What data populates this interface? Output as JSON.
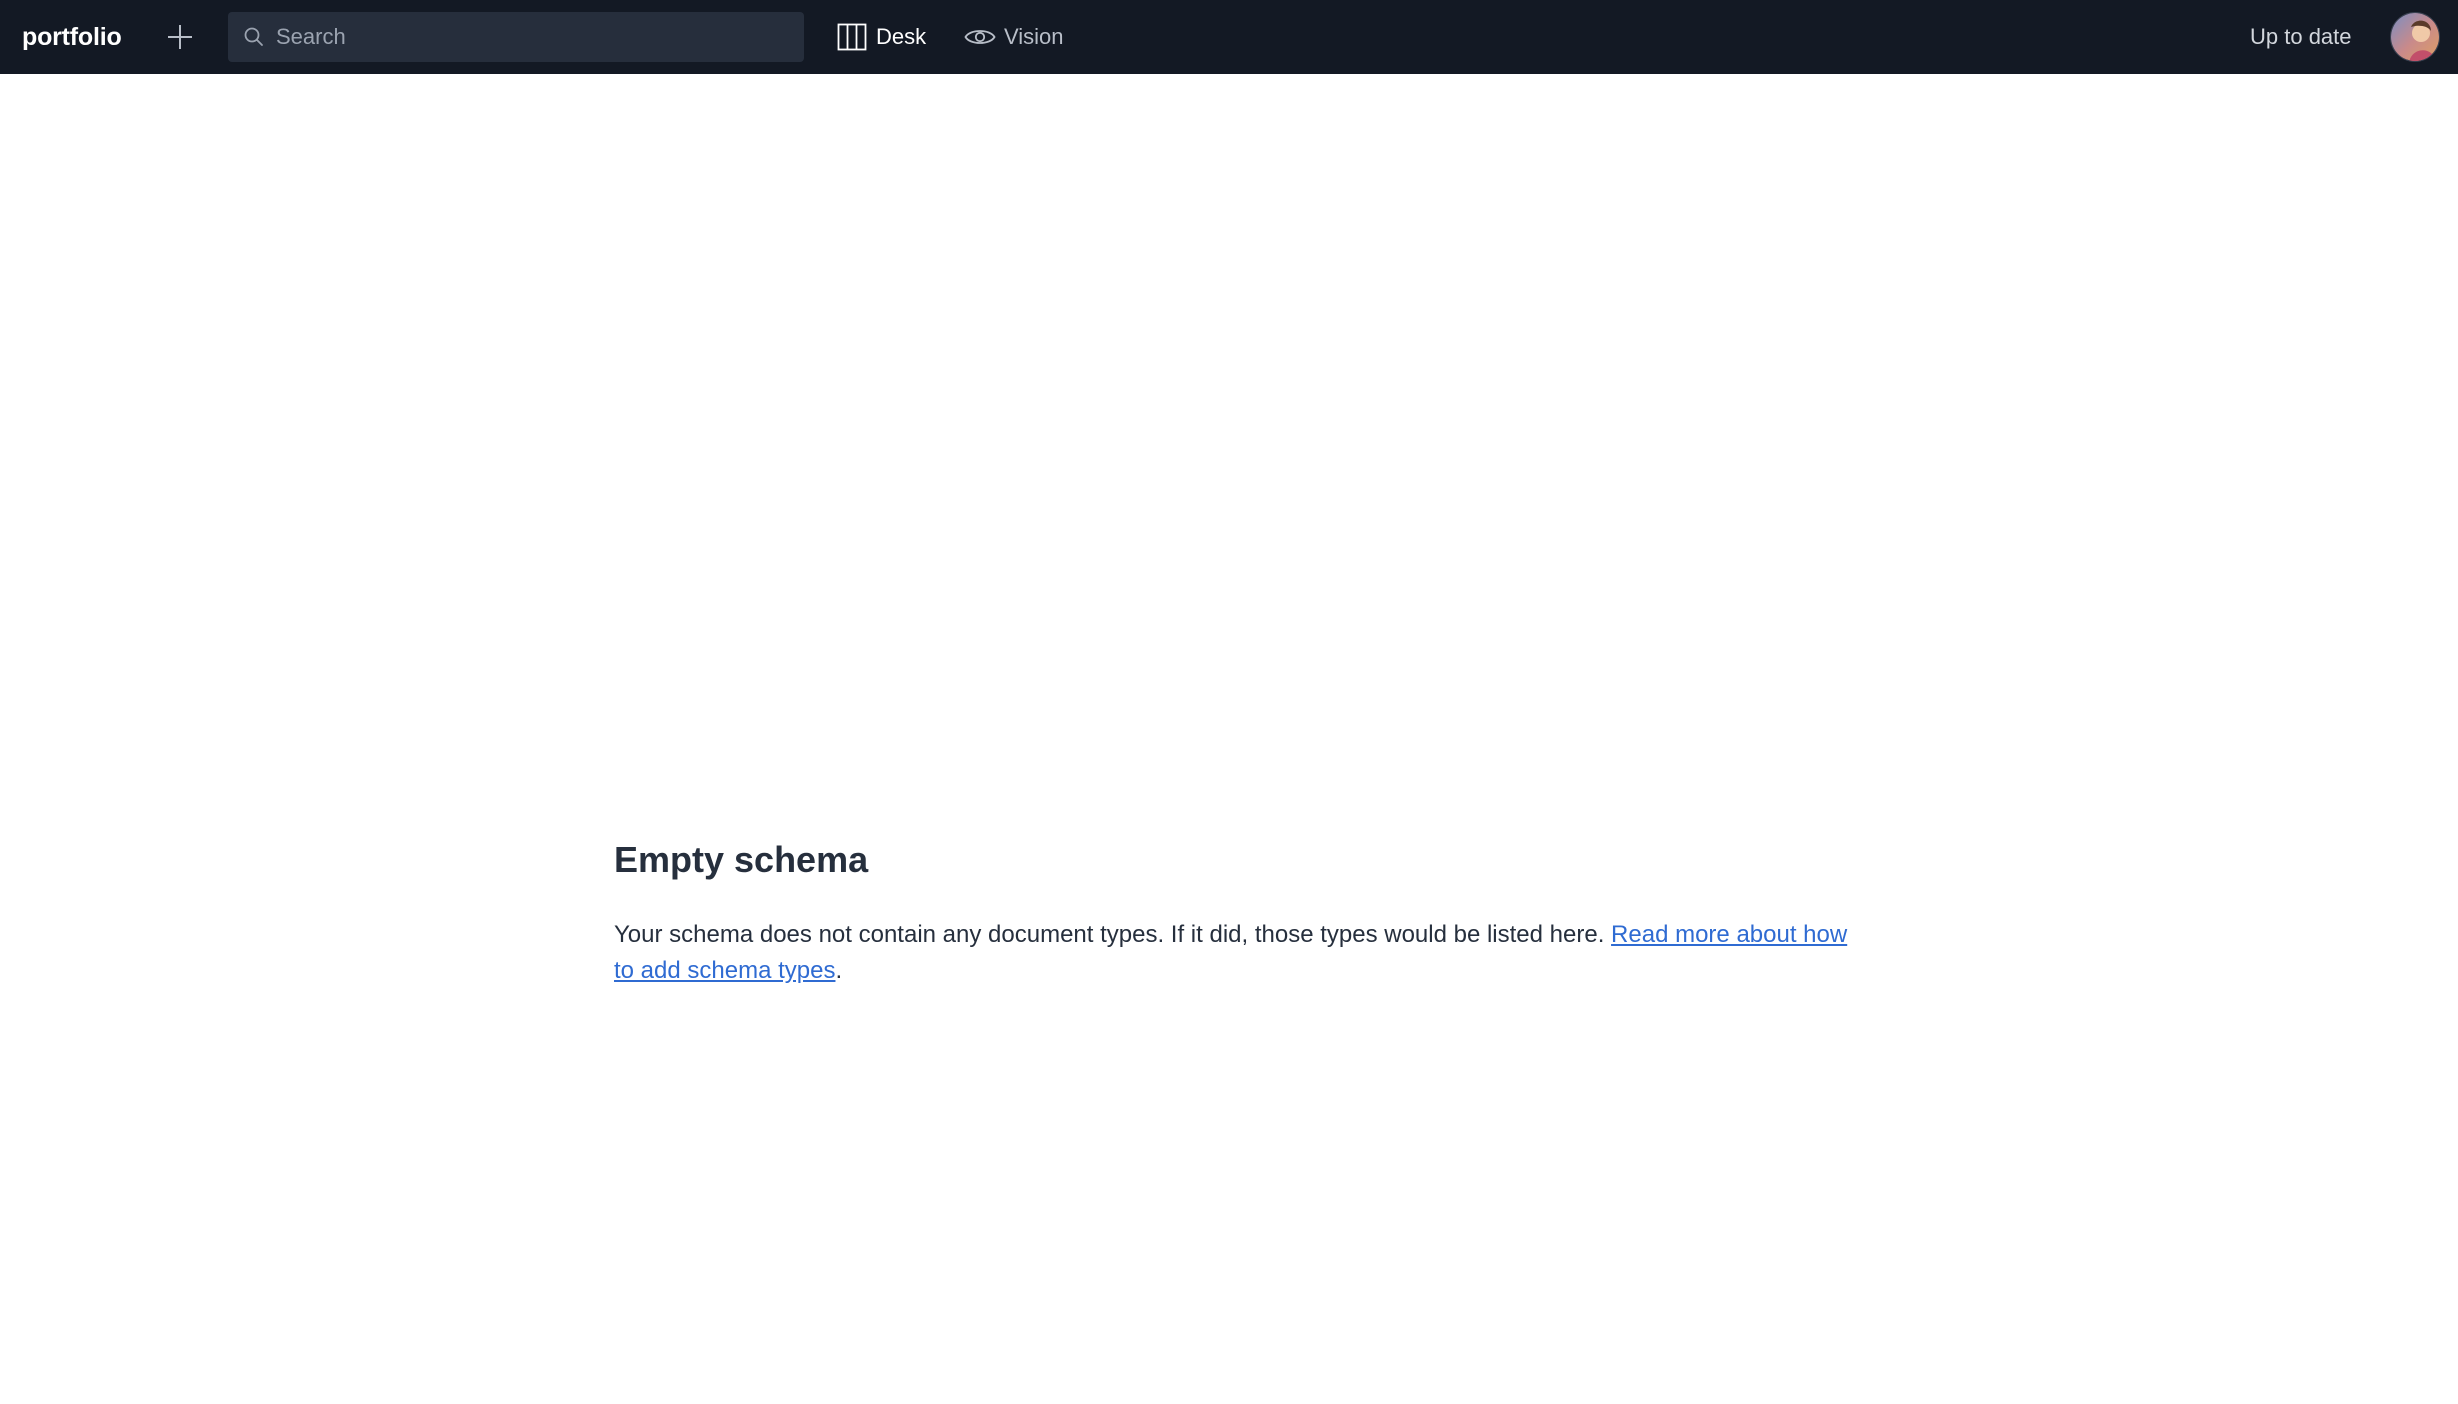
{
  "navbar": {
    "brand": "portfolio",
    "new_icon": "plus-icon",
    "search": {
      "placeholder": "Search",
      "value": "",
      "icon": "search-icon"
    },
    "tools": [
      {
        "label": "Desk",
        "icon": "columns-icon",
        "active": true
      },
      {
        "label": "Vision",
        "icon": "eye-icon",
        "active": false
      }
    ],
    "status": "Up to date",
    "avatar_icon": "user-avatar"
  },
  "main": {
    "title": "Empty schema",
    "body_text": "Your schema does not contain any document types. If it did, those types would be listed here. ",
    "link_text": "Read more about how to add schema types",
    "trailing": "."
  },
  "colors": {
    "navbar_bg": "#131924",
    "search_bg": "#262e3c",
    "link": "#2f6bd2",
    "text": "#262f3d"
  }
}
